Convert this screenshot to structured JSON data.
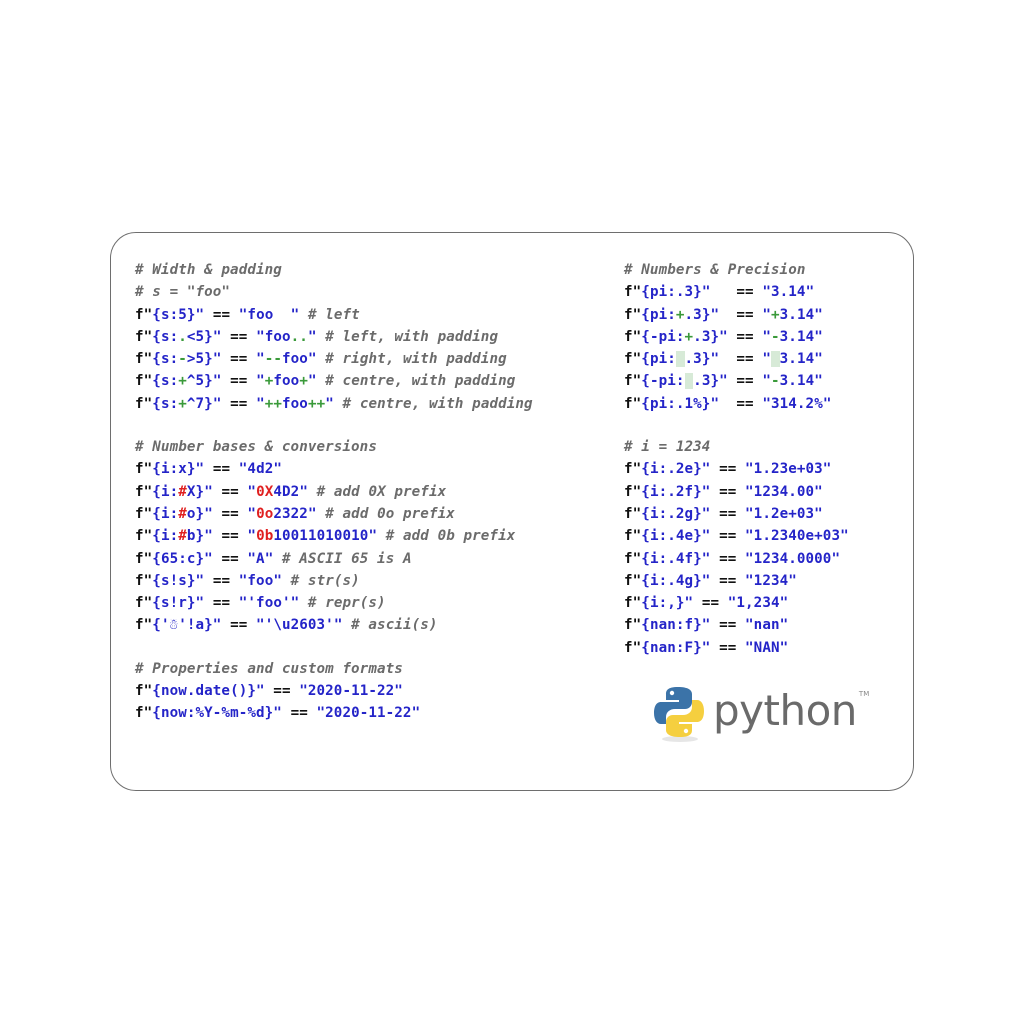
{
  "sections": {
    "width_padding": {
      "title": "# Width & padding",
      "setup": "# s = \"foo\"",
      "rows": [
        {
          "prefix": "f\"",
          "pre": "{s:",
          "hl": "",
          "post": "5}",
          "q": "\"",
          "eq": " == ",
          "v_open": "\"",
          "v_hl1": "",
          "v_mid": "foo  ",
          "v_hl2": "",
          "v_close": "\"",
          "comment": " # left"
        },
        {
          "prefix": "f\"",
          "pre": "{s:",
          "hl": ".",
          "post": "<5}",
          "q": "\"",
          "eq": " == ",
          "v_open": "\"",
          "v_hl1": "",
          "v_mid": "foo",
          "v_hl2": "..",
          "v_close": "\"",
          "comment": " # left, with padding"
        },
        {
          "prefix": "f\"",
          "pre": "{s:",
          "hl": "-",
          "post": ">5}",
          "q": "\"",
          "eq": " == ",
          "v_open": "\"",
          "v_hl1": "--",
          "v_mid": "foo",
          "v_hl2": "",
          "v_close": "\"",
          "comment": " # right, with padding"
        },
        {
          "prefix": "f\"",
          "pre": "{s:",
          "hl": "+",
          "post": "^5}",
          "q": "\"",
          "eq": " == ",
          "v_open": "\"",
          "v_hl1": "+",
          "v_mid": "foo",
          "v_hl2": "+",
          "v_close": "\"",
          "comment": " # centre, with padding"
        },
        {
          "prefix": "f\"",
          "pre": "{s:",
          "hl": "+",
          "post": "^7}",
          "q": "\"",
          "eq": " == ",
          "v_open": "\"",
          "v_hl1": "++",
          "v_mid": "foo",
          "v_hl2": "++",
          "v_close": "\"",
          "comment": " # centre, with padding"
        }
      ]
    },
    "bases": {
      "title": "# Number bases & conversions",
      "rows": [
        {
          "prefix": "f\"",
          "pre": "{i:",
          "hl": "",
          "post": "x}",
          "q": "\"",
          "eq": " == ",
          "v_open": "\"",
          "v_hl1": "",
          "v_mid": "4d2",
          "v_close": "\"",
          "comment": ""
        },
        {
          "prefix": "f\"",
          "pre": "{i:",
          "hl": "#",
          "post": "X}",
          "q": "\"",
          "eq": " == ",
          "v_open": "\"",
          "v_hl1": "0X",
          "v_mid": "4D2",
          "v_close": "\"",
          "comment": " # add 0X prefix"
        },
        {
          "prefix": "f\"",
          "pre": "{i:",
          "hl": "#",
          "post": "o}",
          "q": "\"",
          "eq": " == ",
          "v_open": "\"",
          "v_hl1": "0o",
          "v_mid": "2322",
          "v_close": "\"",
          "comment": " # add 0o prefix"
        },
        {
          "prefix": "f\"",
          "pre": "{i:",
          "hl": "#",
          "post": "b}",
          "q": "\"",
          "eq": " == ",
          "v_open": "\"",
          "v_hl1": "0b",
          "v_mid": "10011010010",
          "v_close": "\"",
          "comment": " # add 0b prefix"
        },
        {
          "prefix": "f\"",
          "pre": "{65:c}",
          "hl": "",
          "post": "",
          "q": "\"",
          "eq": " == ",
          "v_open": "\"",
          "v_hl1": "",
          "v_mid": "A",
          "v_close": "\"",
          "comment": " # ASCII 65 is A"
        },
        {
          "prefix": "f\"",
          "pre": "{s!s}",
          "hl": "",
          "post": "",
          "q": "\"",
          "eq": " == ",
          "v_open": "\"",
          "v_hl1": "",
          "v_mid": "foo",
          "v_close": "\"",
          "comment": " # str(s)"
        },
        {
          "prefix": "f\"",
          "pre": "{s!r}",
          "hl": "",
          "post": "",
          "q": "\"",
          "eq": " == ",
          "v_open": "\"",
          "v_hl1": "",
          "v_mid": "'foo'",
          "v_close": "\"",
          "comment": " # repr(s)"
        },
        {
          "prefix": "f\"",
          "pre": "{'☃'!a}",
          "hl": "",
          "post": "",
          "q": "\"",
          "eq": " == ",
          "v_open": "\"",
          "v_hl1": "",
          "v_mid": "'\\u2603'",
          "v_close": "\"",
          "comment": " # ascii(s)"
        }
      ]
    },
    "properties": {
      "title": "# Properties and custom formats",
      "rows": [
        {
          "prefix": "f\"",
          "pre": "{now.date()}",
          "q": "\"",
          "eq": " == ",
          "value": "\"2020-11-22\""
        },
        {
          "prefix": "f\"",
          "pre": "{now:%Y-%m-%d}",
          "q": "\"",
          "eq": " == ",
          "value": "\"2020-11-22\""
        }
      ]
    },
    "precision": {
      "title": "# Numbers & Precision",
      "rows": [
        {
          "prefix": "f\"",
          "pre": "{pi:",
          "hl": "",
          "space": false,
          "post": ".3}",
          "q": "\"",
          "eq": "   == ",
          "v_open": "\"",
          "v_hl": "",
          "v_space": false,
          "v_mid": "3.14",
          "v_close": "\""
        },
        {
          "prefix": "f\"",
          "pre": "{pi:",
          "hl": "+",
          "space": false,
          "post": ".3}",
          "q": "\"",
          "eq": "  == ",
          "v_open": "\"",
          "v_hl": "+",
          "v_space": false,
          "v_mid": "3.14",
          "v_close": "\""
        },
        {
          "prefix": "f\"",
          "pre": "{-pi:",
          "hl": "+",
          "space": false,
          "post": ".3}",
          "q": "\"",
          "eq": " == ",
          "v_open": "\"",
          "v_hl": "-",
          "v_space": false,
          "v_mid": "3.14",
          "v_close": "\""
        },
        {
          "prefix": "f\"",
          "pre": "{pi:",
          "hl": "",
          "space": true,
          "post": ".3}",
          "q": "\"",
          "eq": "  == ",
          "v_open": "\"",
          "v_hl": "",
          "v_space": true,
          "v_mid": "3.14",
          "v_close": "\""
        },
        {
          "prefix": "f\"",
          "pre": "{-pi:",
          "hl": "",
          "space": true,
          "post": ".3}",
          "q": "\"",
          "eq": " == ",
          "v_open": "\"",
          "v_hl": "-",
          "v_space": false,
          "v_mid": "3.14",
          "v_close": "\""
        },
        {
          "prefix": "f\"",
          "pre": "{pi:",
          "hl": "",
          "space": false,
          "post": ".1%}",
          "q": "\"",
          "eq": "  == ",
          "v_open": "\"",
          "v_hl": "",
          "v_space": false,
          "v_mid": "314.2%",
          "v_close": "\""
        }
      ]
    },
    "integer": {
      "title": "# i = 1234",
      "rows": [
        {
          "prefix": "f\"",
          "pre": "{i:.2e}",
          "q": "\"",
          "eq": " == ",
          "value": "\"1.23e+03\""
        },
        {
          "prefix": "f\"",
          "pre": "{i:.2f}",
          "q": "\"",
          "eq": " == ",
          "value": "\"1234.00\""
        },
        {
          "prefix": "f\"",
          "pre": "{i:.2g}",
          "q": "\"",
          "eq": " == ",
          "value": "\"1.2e+03\""
        },
        {
          "prefix": "f\"",
          "pre": "{i:.4e}",
          "q": "\"",
          "eq": " == ",
          "value": "\"1.2340e+03\""
        },
        {
          "prefix": "f\"",
          "pre": "{i:.4f}",
          "q": "\"",
          "eq": " == ",
          "value": "\"1234.0000\""
        },
        {
          "prefix": "f\"",
          "pre": "{i:.4g}",
          "q": "\"",
          "eq": " == ",
          "value": "\"1234\""
        },
        {
          "prefix": "f\"",
          "pre": "{i:,}",
          "q": "\"",
          "eq": " == ",
          "value": "\"1,234\""
        },
        {
          "prefix": "f\"",
          "pre": "{nan:f}",
          "q": "\"",
          "eq": " == ",
          "value": "\"nan\""
        },
        {
          "prefix": "f\"",
          "pre": "{nan:F}",
          "q": "\"",
          "eq": " == ",
          "value": "\"NAN\""
        }
      ]
    }
  },
  "logo": {
    "word": "python",
    "trademark": "TM",
    "colors": {
      "blue": "#3b73a8",
      "yellow": "#f5cf3f",
      "text": "#6a6a6a"
    }
  },
  "colors": {
    "comment": "#6b6b6b",
    "keyword": "#111111",
    "string": "#2424c8",
    "prefix_highlight": "#e02020",
    "fill_highlight": "#3a9a3a",
    "space_highlight": "#d7ead7"
  }
}
